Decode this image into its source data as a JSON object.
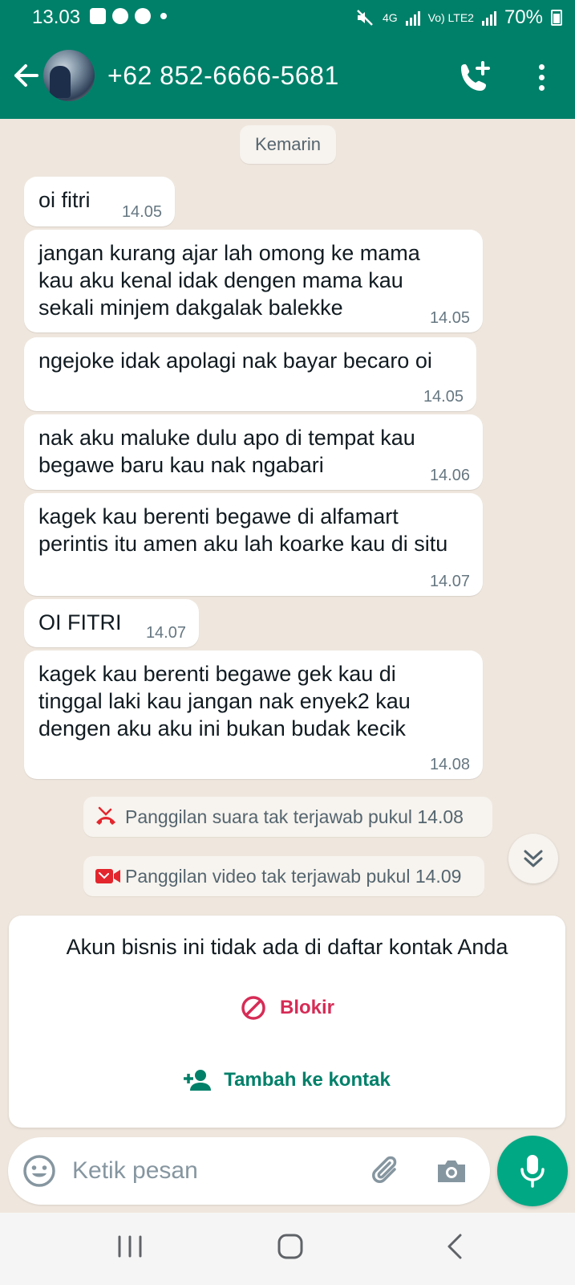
{
  "status_bar": {
    "time": "13.03",
    "network_4g": "4G",
    "network_volte": "Vo) LTE2",
    "battery": "70%"
  },
  "header": {
    "contact": "+62 852-6666-5681"
  },
  "chat": {
    "date_chip": "Kemarin",
    "messages": [
      {
        "text": "oi fitri",
        "time": "14.05"
      },
      {
        "text": "jangan kurang ajar lah omong ke mama kau aku kenal idak dengen mama kau sekali minjem dakgalak balekke",
        "time": "14.05"
      },
      {
        "text": "ngejoke idak apolagi nak bayar becaro oi",
        "time": "14.05"
      },
      {
        "text": "nak aku maluke dulu apo di tempat kau begawe baru kau nak ngabari",
        "time": "14.06"
      },
      {
        "text": "kagek kau berenti begawe di alfamart perintis itu amen aku lah koarke kau di situ",
        "time": "14.07"
      },
      {
        "text": "OI FITRI",
        "time": "14.07"
      },
      {
        "text": "kagek kau berenti begawe gek kau di tinggal laki kau jangan nak enyek2 kau dengen aku aku ini bukan budak kecik",
        "time": "14.08"
      }
    ],
    "system": [
      {
        "text": "Panggilan suara tak terjawab pukul 14.08",
        "icon": "missed-voice-call-icon"
      },
      {
        "text": "Panggilan video tak terjawab pukul 14.09",
        "icon": "missed-video-call-icon"
      }
    ]
  },
  "business_card": {
    "title": "Akun bisnis ini tidak ada di daftar kontak Anda",
    "block_label": "Blokir",
    "add_label": "Tambah ke kontak"
  },
  "composer": {
    "placeholder": "Ketik pesan"
  },
  "colors": {
    "header": "#008069",
    "accent": "#00a884",
    "danger": "#d62c56",
    "chat_bg": "#efe7de",
    "missed_call": "#e3262d"
  }
}
